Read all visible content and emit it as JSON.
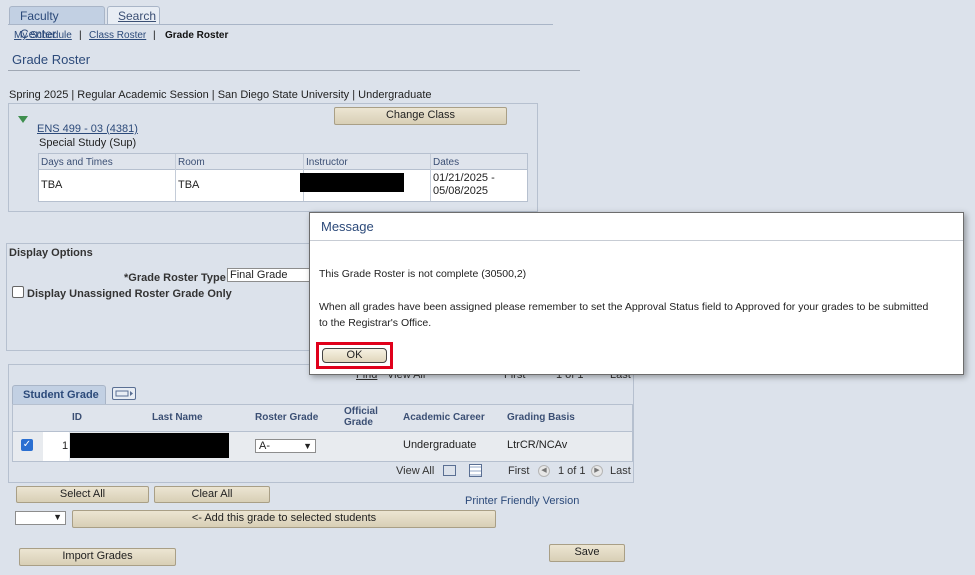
{
  "tabs": [
    {
      "label": "Faculty Center"
    },
    {
      "label": "Search"
    }
  ],
  "breadcrumb": {
    "schedule": "My Schedule",
    "class_roster": "Class Roster",
    "current": "Grade Roster",
    "sep": "|"
  },
  "page_title": "Grade Roster",
  "term_line": "Spring 2025 | Regular Academic Session | San Diego State University | Undergraduate",
  "class_info": {
    "change_class": "Change Class",
    "class_link": "ENS 499 - 03 (4381)",
    "description": "Special Study (Sup)",
    "headers": [
      "Days and Times",
      "Room",
      "Instructor",
      "Dates"
    ],
    "row": {
      "days": "TBA",
      "room": "TBA",
      "dates_1": "01/21/2025 -",
      "dates_2": "05/08/2025"
    }
  },
  "display_options": {
    "title": "Display Options",
    "roster_type_label": "*Grade Roster Type",
    "roster_type_value": "Final Grade",
    "unassigned_label": "Display Unassigned Roster Grade Only"
  },
  "student_grade": {
    "tab_label": "Student Grade",
    "top_nav": {
      "find": "Find",
      "view_all": "View All",
      "first": "First",
      "range": "1 of 1",
      "last": "Last"
    },
    "headers": [
      "ID",
      "Last Name",
      "Roster Grade",
      "Official Grade",
      "Academic Career",
      "Grading Basis"
    ],
    "row": {
      "num": "1",
      "roster_grade": "A-",
      "academic_career": "Undergraduate",
      "grading_basis": "LtrCR/NCAv"
    },
    "bottom_nav": {
      "view_all": "View All",
      "first": "First",
      "range": "1 of 1",
      "last": "Last"
    }
  },
  "actions": {
    "select_all": "Select All",
    "clear_all": "Clear All",
    "printer_friendly": "Printer Friendly Version",
    "add_grade": "<- Add this grade to selected students",
    "import_grades": "Import Grades",
    "save": "Save"
  },
  "dialog": {
    "title": "Message",
    "line1": "This Grade Roster is not complete (30500,2)",
    "line2a": "When all grades have been assigned please remember to set the Approval Status field to Approved for your grades to be submitted",
    "line2b": "to the Registrar's Office.",
    "ok": "OK"
  },
  "colors": {
    "accent": "#2c4a7a",
    "highlight": "#e0001b"
  }
}
